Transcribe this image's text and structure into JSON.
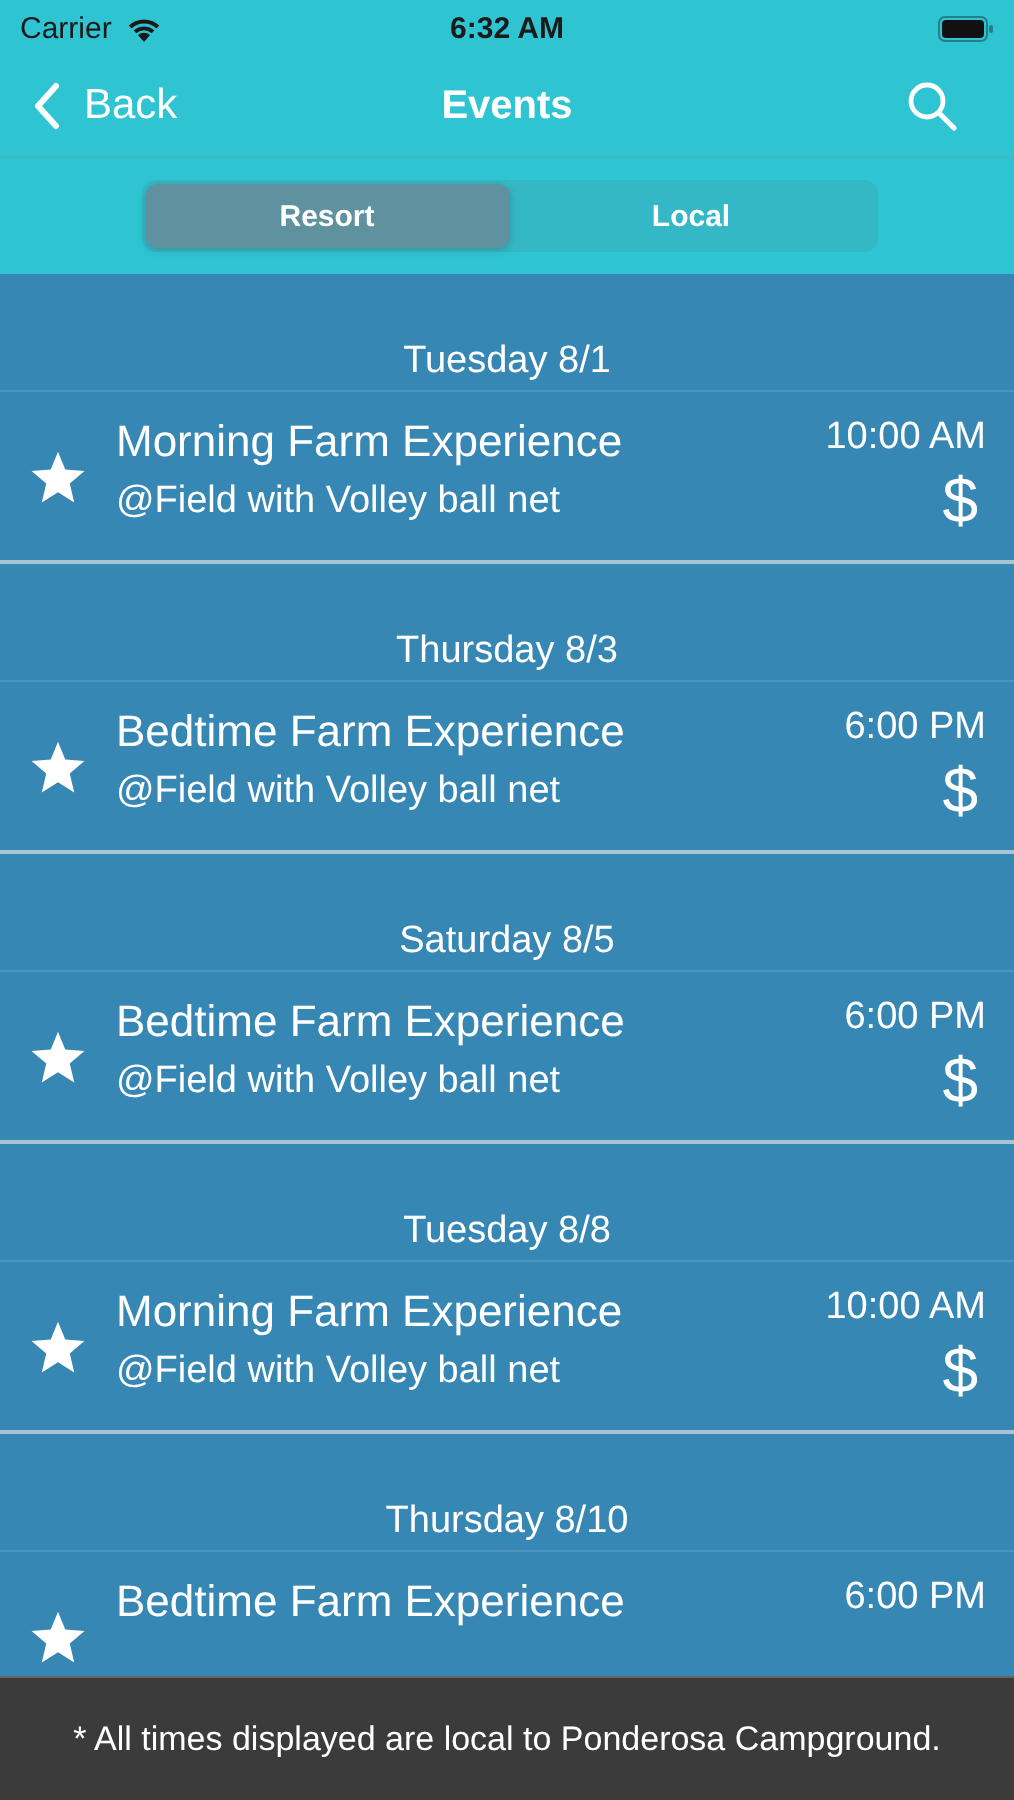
{
  "status_bar": {
    "carrier": "Carrier",
    "time": "6:32 AM"
  },
  "nav": {
    "back": "Back",
    "title": "Events"
  },
  "tabs": [
    {
      "label": "Resort",
      "selected": true
    },
    {
      "label": "Local",
      "selected": false
    }
  ],
  "days": [
    {
      "date": "Tuesday 8/1",
      "events": [
        {
          "title": "Morning Farm Experience",
          "location": "@Field with Volley ball net",
          "time": "10:00 AM",
          "price": "$"
        }
      ]
    },
    {
      "date": "Thursday 8/3",
      "events": [
        {
          "title": "Bedtime Farm Experience",
          "location": "@Field with Volley ball net",
          "time": "6:00 PM",
          "price": "$"
        }
      ]
    },
    {
      "date": "Saturday 8/5",
      "events": [
        {
          "title": "Bedtime Farm Experience",
          "location": "@Field with Volley ball net",
          "time": "6:00 PM",
          "price": "$"
        }
      ]
    },
    {
      "date": "Tuesday 8/8",
      "events": [
        {
          "title": "Morning Farm Experience",
          "location": "@Field with Volley ball net",
          "time": "10:00 AM",
          "price": "$"
        }
      ]
    },
    {
      "date": "Thursday 8/10",
      "events": [
        {
          "title": "Bedtime Farm Experience",
          "time": "6:00 PM"
        }
      ]
    }
  ],
  "footer": "* All times displayed are local to Ponderosa Campground."
}
